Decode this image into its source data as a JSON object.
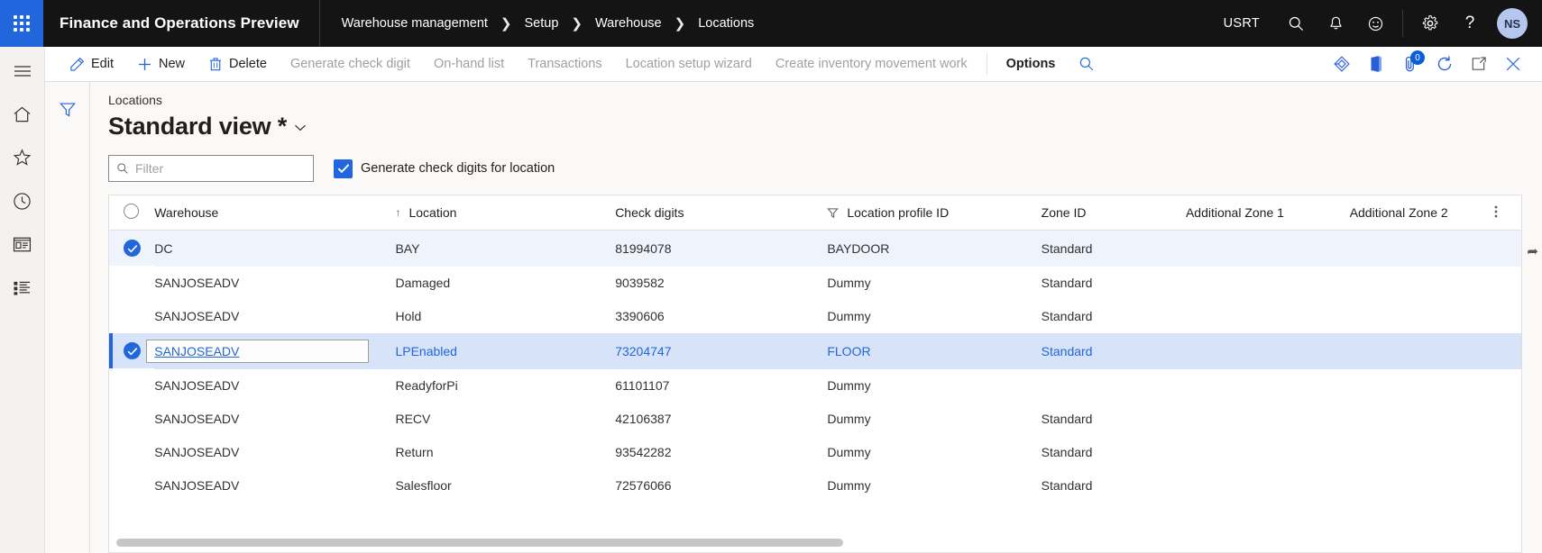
{
  "topbar": {
    "waffle_icon": "waffle-grid-icon",
    "app_title": "Finance and Operations Preview",
    "breadcrumb": [
      "Warehouse management",
      "Setup",
      "Warehouse",
      "Locations"
    ],
    "company": "USRT",
    "icons": [
      "search-icon",
      "bell-icon",
      "smiley-icon",
      "gear-icon",
      "help-icon"
    ],
    "avatar_initials": "NS"
  },
  "rail": {
    "items": [
      {
        "name": "hamburger-menu-icon",
        "label": "Expand navigation"
      },
      {
        "name": "home-icon",
        "label": "Home"
      },
      {
        "name": "star-icon",
        "label": "Favorites"
      },
      {
        "name": "clock-icon",
        "label": "Recent"
      },
      {
        "name": "workspace-icon",
        "label": "Workspaces"
      },
      {
        "name": "modules-icon",
        "label": "Modules"
      }
    ]
  },
  "actionpane": {
    "buttons": [
      {
        "label": "Edit",
        "icon": "pencil-icon",
        "disabled": false,
        "emphasis": false
      },
      {
        "label": "New",
        "icon": "plus-icon",
        "disabled": false,
        "emphasis": false
      },
      {
        "label": "Delete",
        "icon": "trash-icon",
        "disabled": false,
        "emphasis": false
      },
      {
        "label": "Generate check digit",
        "icon": "",
        "disabled": true,
        "emphasis": false
      },
      {
        "label": "On-hand list",
        "icon": "",
        "disabled": true,
        "emphasis": false
      },
      {
        "label": "Transactions",
        "icon": "",
        "disabled": true,
        "emphasis": false
      },
      {
        "label": "Location setup wizard",
        "icon": "",
        "disabled": true,
        "emphasis": false
      },
      {
        "label": "Create inventory movement work",
        "icon": "",
        "disabled": true,
        "emphasis": false
      },
      {
        "label": "Options",
        "icon": "",
        "disabled": false,
        "emphasis": true
      }
    ],
    "search_icon": "search-icon",
    "right_icons": [
      {
        "name": "share-diamond-icon",
        "badge": null
      },
      {
        "name": "open-in-office-icon",
        "badge": null
      },
      {
        "name": "attachments-icon",
        "badge": "0"
      },
      {
        "name": "refresh-icon",
        "badge": null
      },
      {
        "name": "popout-icon",
        "badge": null
      },
      {
        "name": "close-icon",
        "badge": null
      }
    ]
  },
  "page": {
    "filter_rail_icon": "filter-funnel-icon",
    "caption": "Locations",
    "view_title": "Standard view *",
    "view_chevron": "chevron-down-icon",
    "filter": {
      "placeholder": "Filter",
      "value": "",
      "icon": "search-icon"
    },
    "checkbox": {
      "label": "Generate check digits for location",
      "checked": true
    }
  },
  "grid": {
    "columns": [
      {
        "key": "select",
        "label": ""
      },
      {
        "key": "warehouse",
        "label": "Warehouse",
        "sorted": "asc"
      },
      {
        "key": "location",
        "label": "Location"
      },
      {
        "key": "checkdigits",
        "label": "Check digits",
        "filtered": true
      },
      {
        "key": "profile",
        "label": "Location profile ID"
      },
      {
        "key": "zone",
        "label": "Zone ID"
      },
      {
        "key": "azone1",
        "label": "Additional Zone 1"
      },
      {
        "key": "azone2",
        "label": "Additional Zone 2"
      }
    ],
    "header_select_icon": "select-all-circle-icon",
    "header_sort_icon": "sort-ascending-arrow-icon",
    "header_filter_icon": "column-filter-icon",
    "header_more_icon": "column-options-icon",
    "rows": [
      {
        "selected": true,
        "active": false,
        "editing": false,
        "warehouse": "DC",
        "location": "BAY",
        "checkdigits": "81994078",
        "profile": "BAYDOOR",
        "zone": "Standard",
        "azone1": "",
        "azone2": ""
      },
      {
        "selected": false,
        "active": false,
        "editing": false,
        "warehouse": "SANJOSEADV",
        "location": "Damaged",
        "checkdigits": "9039582",
        "profile": "Dummy",
        "zone": "Standard",
        "azone1": "",
        "azone2": ""
      },
      {
        "selected": false,
        "active": false,
        "editing": false,
        "warehouse": "SANJOSEADV",
        "location": "Hold",
        "checkdigits": "3390606",
        "profile": "Dummy",
        "zone": "Standard",
        "azone1": "",
        "azone2": ""
      },
      {
        "selected": true,
        "active": true,
        "editing": true,
        "warehouse": "SANJOSEADV",
        "location": "LPEnabled",
        "checkdigits": "73204747",
        "profile": "FLOOR",
        "zone": "Standard",
        "azone1": "",
        "azone2": ""
      },
      {
        "selected": false,
        "active": false,
        "editing": false,
        "warehouse": "SANJOSEADV",
        "location": "ReadyforPi",
        "checkdigits": "61101107",
        "profile": "Dummy",
        "zone": "",
        "azone1": "",
        "azone2": ""
      },
      {
        "selected": false,
        "active": false,
        "editing": false,
        "warehouse": "SANJOSEADV",
        "location": "RECV",
        "checkdigits": "42106387",
        "profile": "Dummy",
        "zone": "Standard",
        "azone1": "",
        "azone2": ""
      },
      {
        "selected": false,
        "active": false,
        "editing": false,
        "warehouse": "SANJOSEADV",
        "location": "Return",
        "checkdigits": "93542282",
        "profile": "Dummy",
        "zone": "Standard",
        "azone1": "",
        "azone2": ""
      },
      {
        "selected": false,
        "active": false,
        "editing": false,
        "warehouse": "SANJOSEADV",
        "location": "Salesfloor",
        "checkdigits": "72576066",
        "profile": "Dummy",
        "zone": "Standard",
        "azone1": "",
        "azone2": ""
      }
    ],
    "hscroll": {
      "thumb_percent": 52
    }
  },
  "colors": {
    "accent": "#2266dd",
    "topbar_bg": "#141414",
    "row_selected": "#d6e3f9",
    "row_highlight": "#eef3fc",
    "disabled_text": "#a19f9d"
  }
}
